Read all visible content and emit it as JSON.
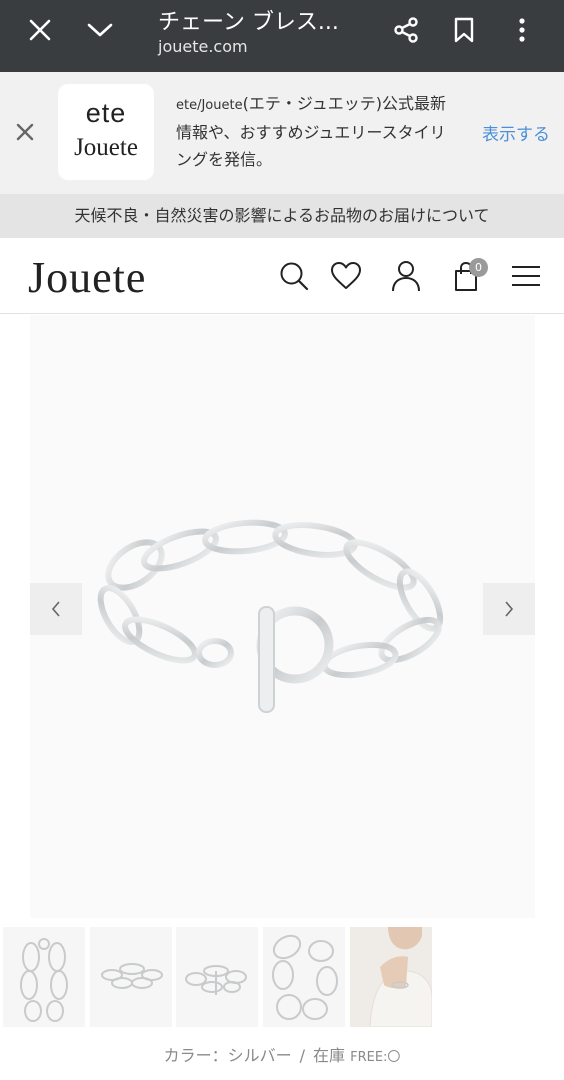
{
  "browser": {
    "title": "チェーン ブレス...",
    "url": "jouete.com"
  },
  "app_banner": {
    "logo_line1": "ete",
    "logo_line2": "Jouete",
    "text_prefix": "ete/Jouete",
    "text_rest_line1": "(エテ・ジュエッテ)公式最新",
    "text_line2": "情報や、おすすめジュエリースタイリ",
    "text_line3": "ングを発信。",
    "action_label": "表示する"
  },
  "notice": {
    "text": "天候不良・自然災害の影響によるお品物のお届けについて"
  },
  "site": {
    "logo": "Jouete",
    "cart_count": "0"
  },
  "product": {
    "color_label": "カラー：シルバー",
    "separator": "/",
    "stock_label": "在庫",
    "stock_value": "FREE:〇"
  },
  "colors": {
    "browser_bg": "#3a3d40",
    "banner_bg": "#f1f1f1",
    "notice_bg": "#e4e4e4",
    "link_blue": "#4a90d9",
    "silver": "#d4d6d8"
  }
}
